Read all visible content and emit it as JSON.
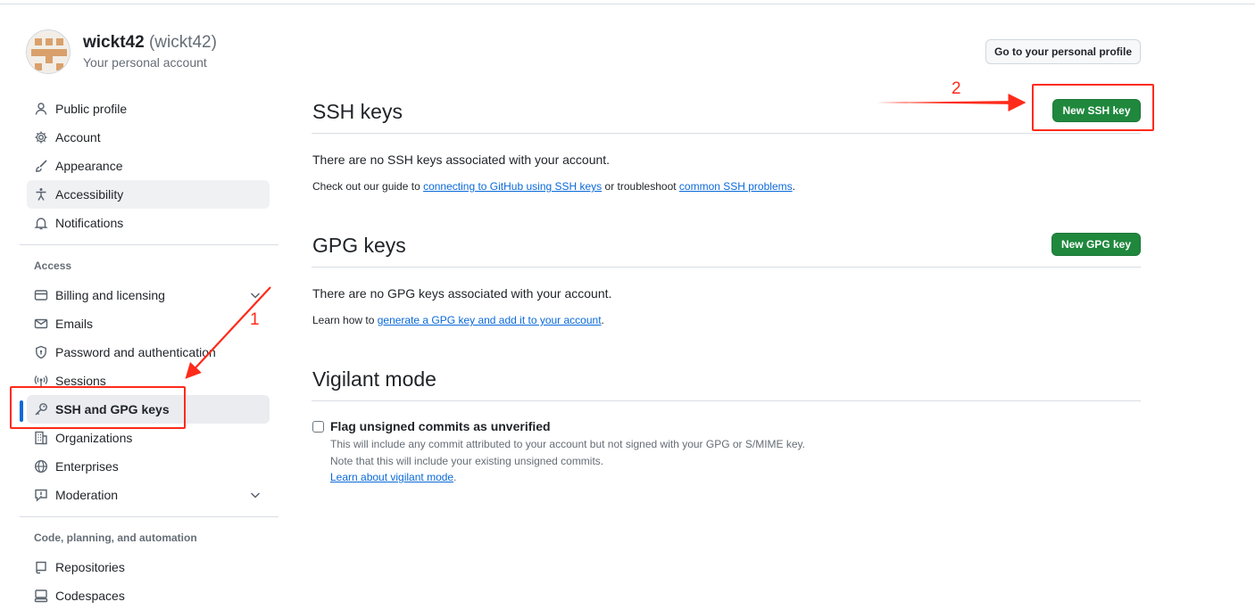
{
  "profile": {
    "name": "wickt42",
    "handle": "(wickt42)",
    "subtitle": "Your personal account",
    "go_to_profile_label": "Go to your personal profile"
  },
  "sidebar": {
    "group1": [
      {
        "label": "Public profile",
        "icon": "person-icon"
      },
      {
        "label": "Account",
        "icon": "gear-icon"
      },
      {
        "label": "Appearance",
        "icon": "paintbrush-icon"
      },
      {
        "label": "Accessibility",
        "icon": "accessibility-icon"
      },
      {
        "label": "Notifications",
        "icon": "bell-icon"
      }
    ],
    "access_heading": "Access",
    "access": [
      {
        "label": "Billing and licensing",
        "icon": "credit-card-icon"
      },
      {
        "label": "Emails",
        "icon": "mail-icon"
      },
      {
        "label": "Password and authentication",
        "icon": "shield-lock-icon"
      },
      {
        "label": "Sessions",
        "icon": "broadcast-icon"
      },
      {
        "label": "SSH and GPG keys",
        "icon": "key-icon"
      },
      {
        "label": "Organizations",
        "icon": "organization-icon"
      },
      {
        "label": "Enterprises",
        "icon": "globe-icon"
      },
      {
        "label": "Moderation",
        "icon": "report-icon"
      }
    ],
    "code_heading": "Code, planning, and automation",
    "code": [
      {
        "label": "Repositories",
        "icon": "repo-icon"
      },
      {
        "label": "Codespaces",
        "icon": "codespaces-icon"
      }
    ]
  },
  "ssh": {
    "title": "SSH keys",
    "button": "New SSH key",
    "empty": "There are no SSH keys associated with your account.",
    "guide_prefix": "Check out our guide to ",
    "guide_link": "connecting to GitHub using SSH keys",
    "guide_middle": " or troubleshoot ",
    "guide_link2": "common SSH problems",
    "guide_suffix": "."
  },
  "gpg": {
    "title": "GPG keys",
    "button": "New GPG key",
    "empty": "There are no GPG keys associated with your account.",
    "learn_prefix": "Learn how to ",
    "learn_link": "generate a GPG key and add it to your account",
    "learn_suffix": "."
  },
  "vigilant": {
    "title": "Vigilant mode",
    "checkbox_label": "Flag unsigned commits as unverified",
    "checked": false,
    "note1": "This will include any commit attributed to your account but not signed with your GPG or S/MIME key.",
    "note2": "Note that this will include your existing unsigned commits.",
    "link": "Learn about vigilant mode",
    "link_suffix": "."
  },
  "annotations": {
    "step1": "1",
    "step2": "2",
    "color": "#ff2a1a"
  },
  "colors": {
    "primary_green": "#1f883d",
    "link_blue": "#0969da",
    "selected_bar": "#0969da"
  }
}
